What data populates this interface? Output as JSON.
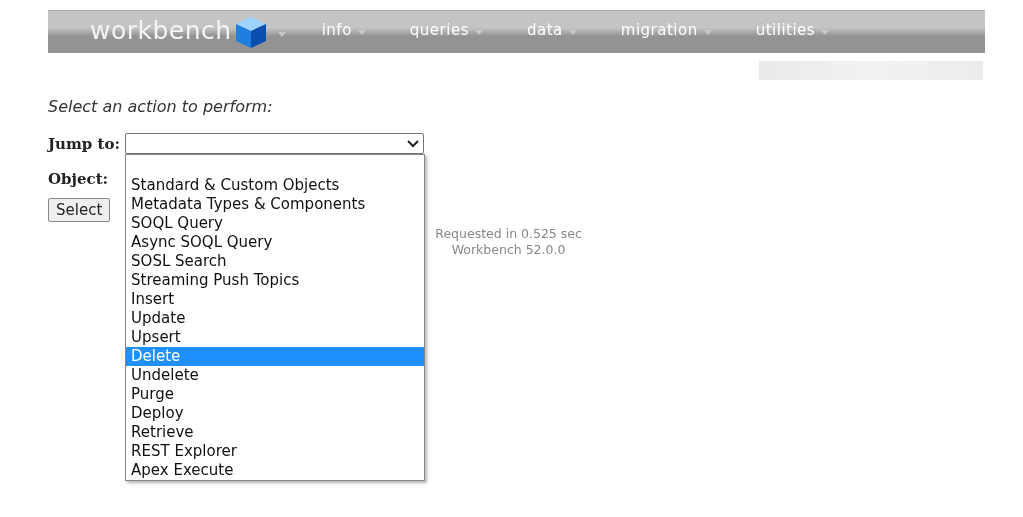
{
  "nav": {
    "logo": "workbench",
    "items": [
      {
        "label": "info"
      },
      {
        "label": "queries"
      },
      {
        "label": "data"
      },
      {
        "label": "migration"
      },
      {
        "label": "utilities"
      }
    ]
  },
  "form": {
    "prompt": "Select an action to perform:",
    "jump_label": "Jump to:",
    "object_label": "Object:",
    "select_button": "Select",
    "options": [
      {
        "label": "Standard & Custom Objects",
        "selected": false
      },
      {
        "label": "Metadata Types & Components",
        "selected": false
      },
      {
        "label": "SOQL Query",
        "selected": false
      },
      {
        "label": "Async SOQL Query",
        "selected": false
      },
      {
        "label": "SOSL Search",
        "selected": false
      },
      {
        "label": "Streaming Push Topics",
        "selected": false
      },
      {
        "label": "Insert",
        "selected": false
      },
      {
        "label": "Update",
        "selected": false
      },
      {
        "label": "Upsert",
        "selected": false
      },
      {
        "label": "Delete",
        "selected": true
      },
      {
        "label": "Undelete",
        "selected": false
      },
      {
        "label": "Purge",
        "selected": false
      },
      {
        "label": "Deploy",
        "selected": false
      },
      {
        "label": "Retrieve",
        "selected": false
      },
      {
        "label": "REST Explorer",
        "selected": false
      },
      {
        "label": "Apex Execute",
        "selected": false
      }
    ]
  },
  "footer": [
    "Requested in 0.525 sec",
    "Workbench 52.0.0"
  ]
}
